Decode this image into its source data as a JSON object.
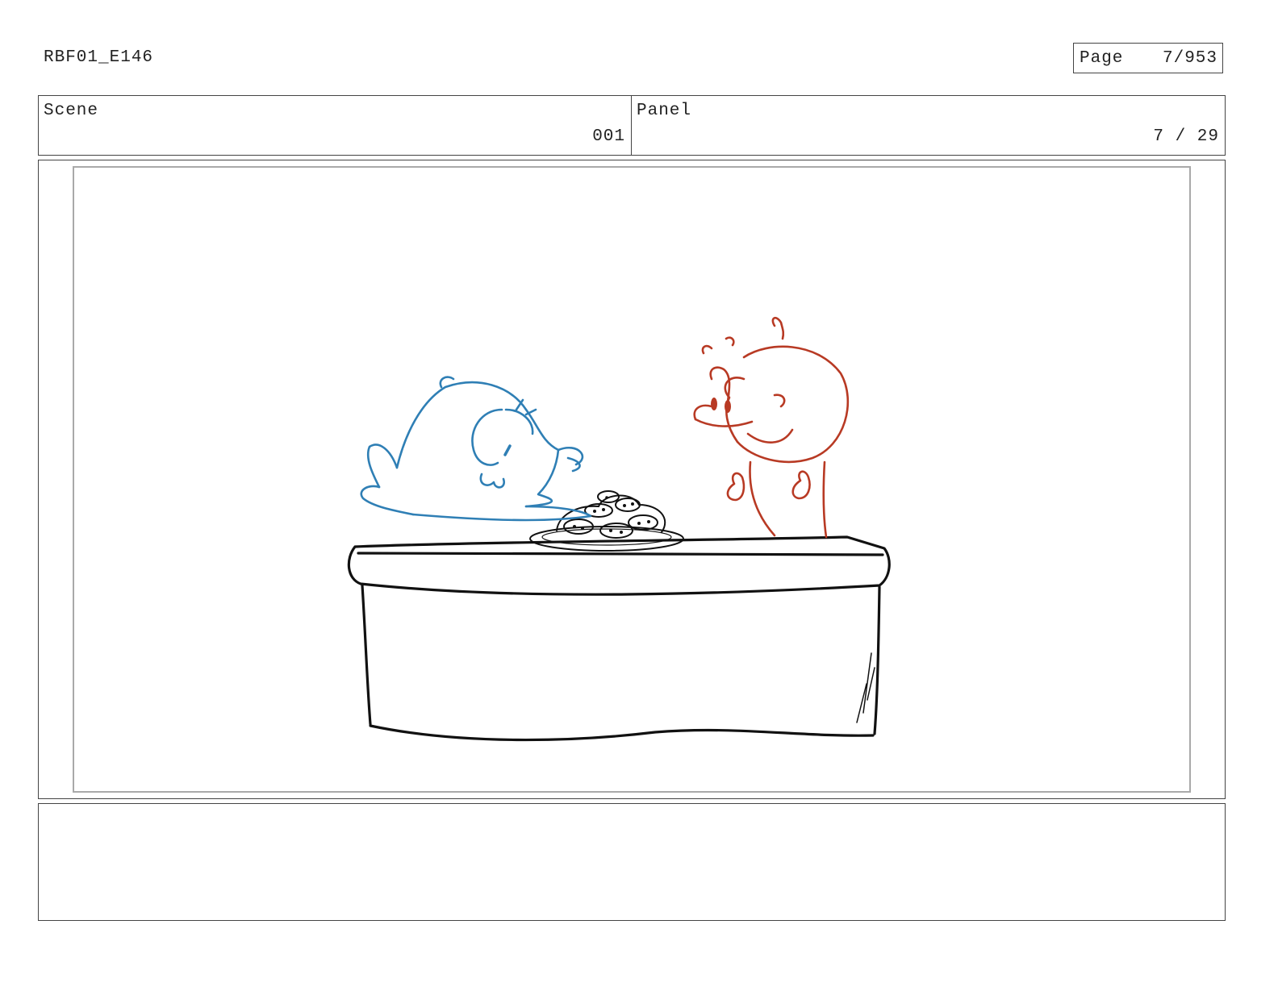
{
  "header": {
    "document_id": "RBF01_E146",
    "page_label": "Page",
    "page_value": "7/953"
  },
  "info": {
    "scene_label": "Scene",
    "scene_value": "001",
    "panel_label": "Panel",
    "panel_value": "7 / 29"
  },
  "frame": {
    "description_colors": {
      "blue_character": "#2f7fb5",
      "red_character": "#b83a24",
      "ink": "#111111"
    }
  },
  "notes": {
    "text": ""
  }
}
